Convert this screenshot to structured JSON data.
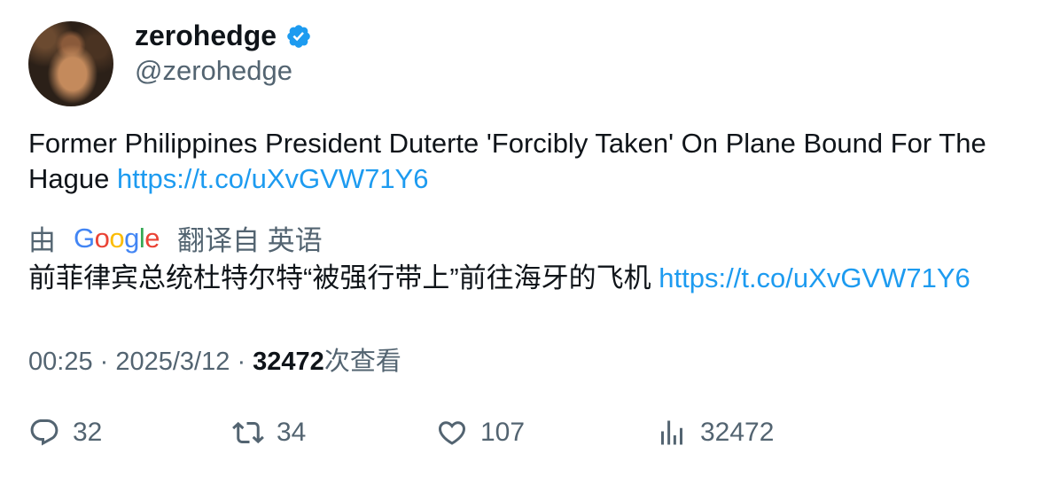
{
  "user": {
    "display_name": "zerohedge",
    "handle": "@zerohedge"
  },
  "tweet": {
    "text": "Former Philippines President Duterte 'Forcibly Taken' On Plane Bound For The Hague",
    "link": "https://t.co/uXvGVW71Y6"
  },
  "translation": {
    "prefix": "由",
    "suffix": "翻译自 英语",
    "text": "前菲律宾总统杜特尔特“被强行带上”前往海牙的飞机",
    "link": "https://t.co/uXvGVW71Y6"
  },
  "meta": {
    "time": "00:25",
    "date": "2025/3/12",
    "views": "32472",
    "views_label": "次查看"
  },
  "actions": {
    "replies": "32",
    "retweets": "34",
    "likes": "107",
    "views": "32472"
  },
  "colors": {
    "link": "#1d9bf0",
    "secondary_text": "#536471",
    "verified": "#1d9bf0"
  }
}
